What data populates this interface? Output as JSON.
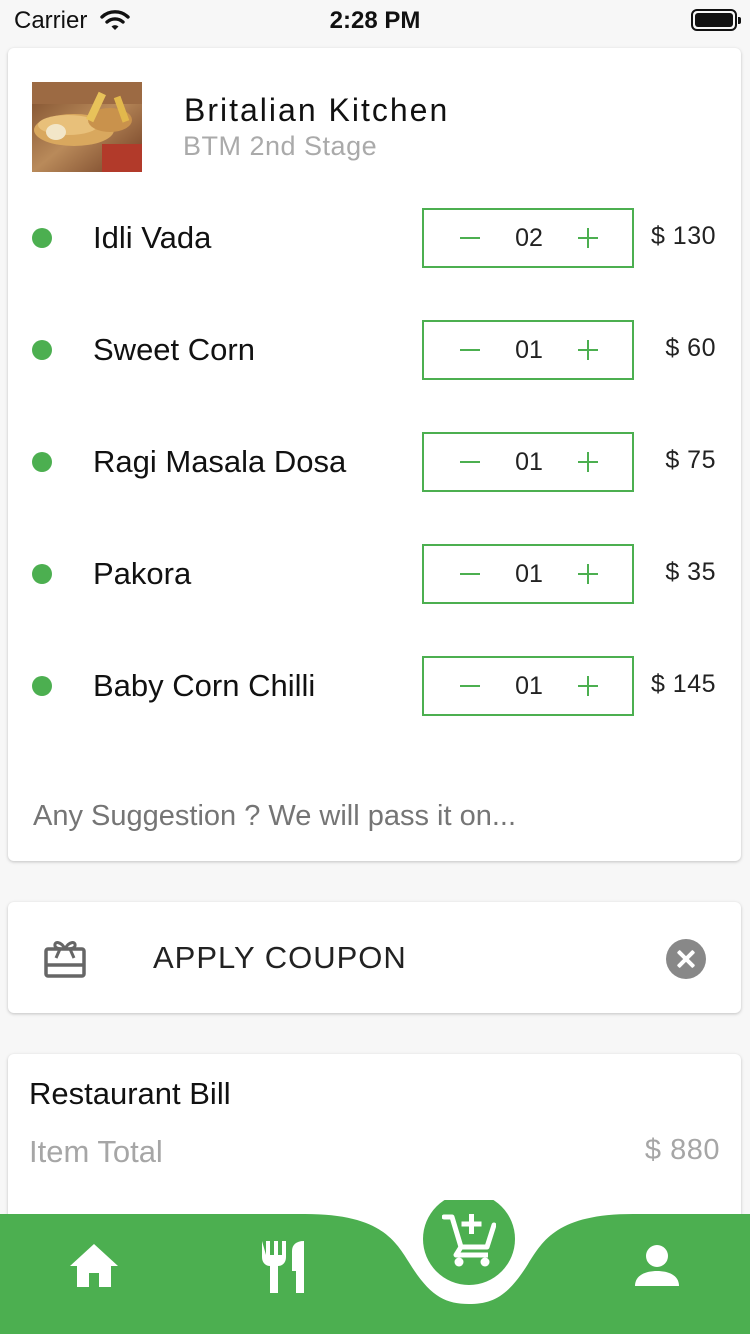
{
  "status_bar": {
    "carrier": "Carrier",
    "time": "2:28 PM"
  },
  "restaurant": {
    "name": "Britalian Kitchen",
    "location": "BTM 2nd Stage"
  },
  "cart": {
    "items": [
      {
        "name": "Idli Vada",
        "qty": "02",
        "price": "$ 130"
      },
      {
        "name": "Sweet Corn",
        "qty": "01",
        "price": "$ 60"
      },
      {
        "name": "Ragi Masala Dosa",
        "qty": "01",
        "price": "$ 75"
      },
      {
        "name": "Pakora",
        "qty": "01",
        "price": "$ 35"
      },
      {
        "name": "Baby Corn Chilli",
        "qty": "01",
        "price": "$ 145"
      }
    ],
    "suggestion_placeholder": "Any Suggestion ? We will pass it on..."
  },
  "coupon": {
    "label": "APPLY COUPON",
    "icon": "gift-card-icon",
    "clear_icon": "close-circle-icon"
  },
  "bill": {
    "title": "Restaurant Bill",
    "item_total_label": "Item Total",
    "item_total_value": "$ 880"
  },
  "bottom_nav": {
    "items": [
      {
        "name": "home",
        "icon": "home-icon"
      },
      {
        "name": "menu",
        "icon": "restaurant-icon"
      },
      {
        "name": "cart",
        "icon": "cart-add-icon",
        "active": true
      },
      {
        "name": "profile",
        "icon": "person-icon"
      }
    ]
  },
  "colors": {
    "accent": "#4caf50",
    "muted_text": "#a6a6a6",
    "background": "#f7f7f7"
  }
}
